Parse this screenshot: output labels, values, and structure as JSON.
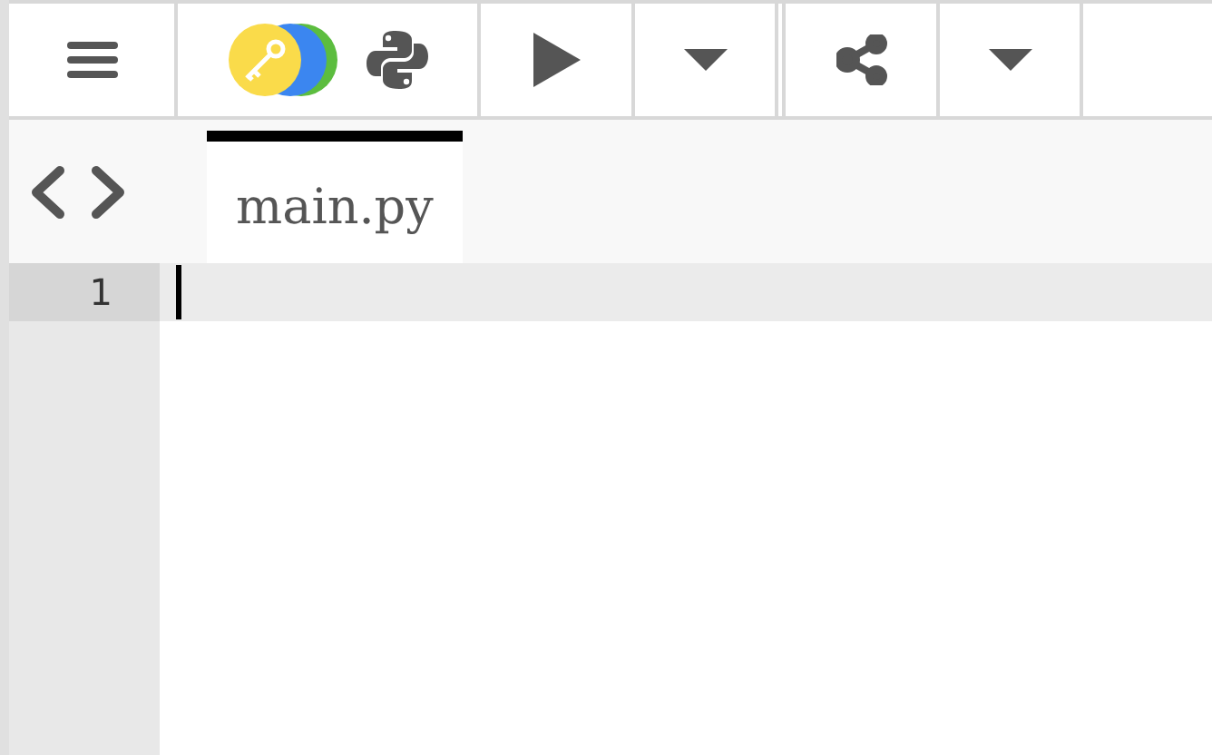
{
  "toolbar": [
    {
      "kind": "menu"
    },
    {
      "kind": "keys"
    },
    {
      "kind": "run"
    },
    {
      "kind": "dropdown"
    },
    {
      "kind": "share"
    },
    {
      "kind": "dropdown"
    }
  ],
  "tabs": [
    {
      "label": "main.py",
      "selected": true
    }
  ],
  "editor": {
    "lines": [
      {
        "number": "1",
        "current": true
      }
    ]
  }
}
